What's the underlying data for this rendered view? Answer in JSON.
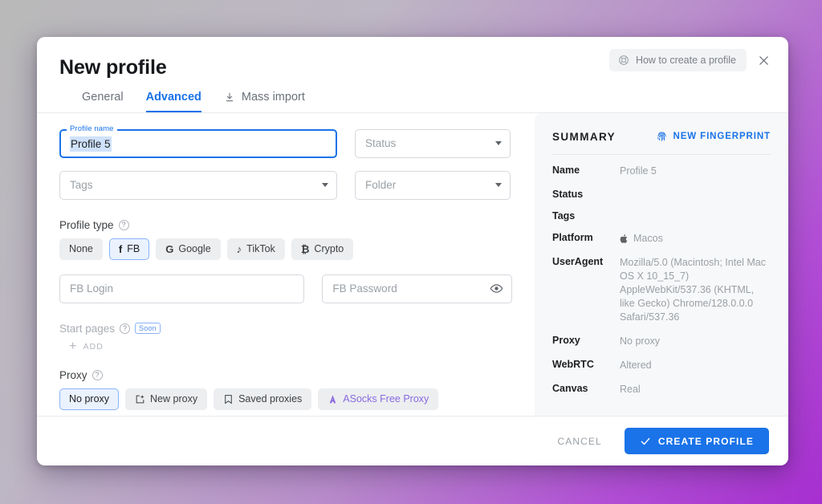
{
  "header": {
    "title": "New profile",
    "help_label": "How to create a profile",
    "help_icon": "lifebuoy-icon",
    "close_icon": "close-icon"
  },
  "tabs": [
    {
      "label": "General",
      "active": false,
      "icon": null
    },
    {
      "label": "Advanced",
      "active": true,
      "icon": null
    },
    {
      "label": "Mass import",
      "active": false,
      "icon": "download-icon"
    }
  ],
  "form": {
    "profile_name": {
      "label": "Profile name",
      "value": "Profile 5",
      "selected": true
    },
    "status": {
      "placeholder": "Status"
    },
    "tags": {
      "placeholder": "Tags"
    },
    "folder": {
      "placeholder": "Folder"
    },
    "profile_type": {
      "label": "Profile type",
      "options": [
        {
          "label": "None",
          "icon": null,
          "selected": false
        },
        {
          "label": "FB",
          "icon": "facebook-icon",
          "selected": true
        },
        {
          "label": "Google",
          "icon": "google-icon",
          "selected": false
        },
        {
          "label": "TikTok",
          "icon": "tiktok-icon",
          "selected": false
        },
        {
          "label": "Crypto",
          "icon": "bitcoin-icon",
          "selected": false
        }
      ]
    },
    "fb_login": {
      "placeholder": "FB Login"
    },
    "fb_password": {
      "placeholder": "FB Password",
      "reveal_icon": "eye-icon"
    },
    "start_pages": {
      "label": "Start pages",
      "badge": "Soon",
      "add_label": "ADD"
    },
    "proxy": {
      "label": "Proxy",
      "options": [
        {
          "label": "No proxy",
          "icon": null,
          "selected": true,
          "accent": false
        },
        {
          "label": "New proxy",
          "icon": "new-proxy-icon",
          "selected": false,
          "accent": false
        },
        {
          "label": "Saved proxies",
          "icon": "bookmark-icon",
          "selected": false,
          "accent": false
        },
        {
          "label": "ASocks Free Proxy",
          "icon": "asocks-icon",
          "selected": false,
          "accent": true
        }
      ]
    }
  },
  "summary": {
    "title": "SUMMARY",
    "new_fingerprint_label": "NEW FINGERPRINT",
    "fingerprint_icon": "fingerprint-icon",
    "rows": [
      {
        "key": "Name",
        "value": "Profile 5",
        "icon": null
      },
      {
        "key": "Status",
        "value": "",
        "icon": null
      },
      {
        "key": "Tags",
        "value": "",
        "icon": null
      },
      {
        "key": "Platform",
        "value": "Macos",
        "icon": "apple-icon"
      },
      {
        "key": "UserAgent",
        "value": "Mozilla/5.0 (Macintosh; Intel Mac OS X 10_15_7) AppleWebKit/537.36 (KHTML, like Gecko) Chrome/128.0.0.0 Safari/537.36",
        "icon": null
      },
      {
        "key": "Proxy",
        "value": "No proxy",
        "icon": null
      },
      {
        "key": "WebRTC",
        "value": "Altered",
        "icon": null
      },
      {
        "key": "Canvas",
        "value": "Real",
        "icon": null
      }
    ]
  },
  "footer": {
    "cancel_label": "CANCEL",
    "create_label": "CREATE PROFILE",
    "create_icon": "check-icon"
  },
  "colors": {
    "accent_blue": "#1a73e8",
    "accent_purple": "#8a6ae0",
    "muted_text": "#9aa0a6",
    "chip_bg": "#eceef0"
  }
}
